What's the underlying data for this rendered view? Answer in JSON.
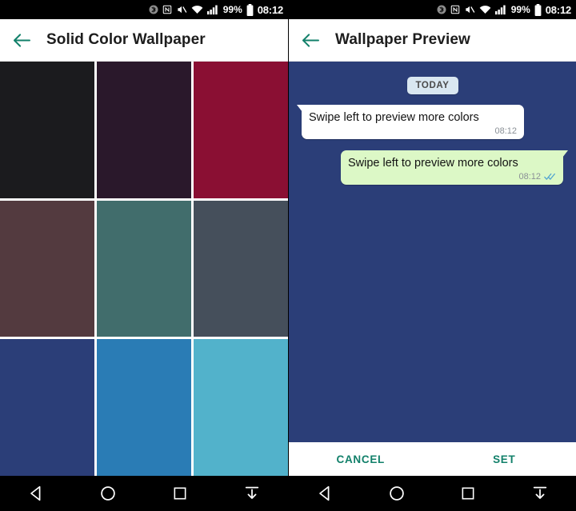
{
  "theme": {
    "accent": "#12806a",
    "statusbar_bg": "#000000",
    "navbar_bg": "#000000",
    "appbar_bg": "#ffffff",
    "title_color": "#1d1d1d"
  },
  "status_bar": {
    "icons": [
      "bluetooth-icon",
      "nfc-icon",
      "mute-icon",
      "wifi-icon",
      "signal-icon"
    ],
    "battery_percent": "99%",
    "battery_icon": "battery-full-icon",
    "time": "08:12"
  },
  "left_screen": {
    "app_bar": {
      "back_icon": "arrow-left-icon",
      "title": "Solid Color Wallpaper"
    },
    "color_grid": {
      "name": "solid-color-swatch-grid",
      "columns": 3,
      "rows": 3,
      "swatches": [
        {
          "name": "swatch-near-black",
          "hex": "#1b1b1e"
        },
        {
          "name": "swatch-dark-purple",
          "hex": "#2a182b"
        },
        {
          "name": "swatch-crimson",
          "hex": "#8a0f33"
        },
        {
          "name": "swatch-maroon",
          "hex": "#533a3f"
        },
        {
          "name": "swatch-teal",
          "hex": "#416d6c"
        },
        {
          "name": "swatch-slate-gray",
          "hex": "#454f5b"
        },
        {
          "name": "swatch-navy-blue",
          "hex": "#2b3e78"
        },
        {
          "name": "swatch-medium-blue",
          "hex": "#2a7cb5"
        },
        {
          "name": "swatch-light-cyan",
          "hex": "#52b2cb"
        }
      ]
    }
  },
  "right_screen": {
    "app_bar": {
      "back_icon": "arrow-left-icon",
      "title": "Wallpaper Preview"
    },
    "preview": {
      "wallpaper_hex": "#2b3e78",
      "day_divider": "TODAY",
      "messages": [
        {
          "name": "incoming-message-bubble",
          "direction": "incoming",
          "text": "Swipe left to preview more colors",
          "time": "08:12",
          "bubble_hex": "#ffffff",
          "status_icon": null
        },
        {
          "name": "outgoing-message-bubble",
          "direction": "outgoing",
          "text": "Swipe left to preview more colors",
          "time": "08:12",
          "bubble_hex": "#dcf8c6",
          "status_icon": "double-check-icon"
        }
      ]
    },
    "actions": {
      "cancel_label": "CANCEL",
      "set_label": "SET"
    }
  },
  "nav_bar": {
    "buttons": [
      {
        "name": "nav-back-button",
        "icon": "triangle-left-icon"
      },
      {
        "name": "nav-home-button",
        "icon": "circle-icon"
      },
      {
        "name": "nav-recents-button",
        "icon": "square-icon"
      },
      {
        "name": "nav-hide-button",
        "icon": "arrow-down-bar-icon"
      }
    ]
  }
}
